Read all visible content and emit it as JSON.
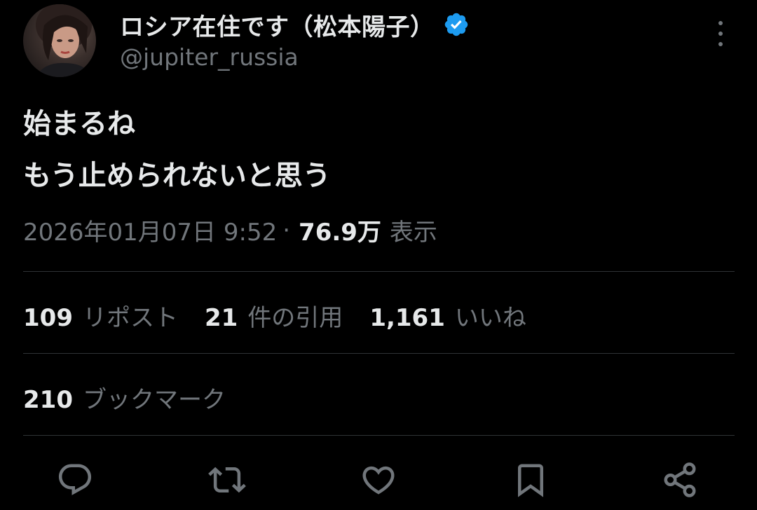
{
  "author": {
    "display_name": "ロシア在住です（松本陽子）",
    "handle": "@jupiter_russia",
    "verified": true
  },
  "tweet": {
    "lines": [
      "始まるね",
      "もう止められないと思う"
    ],
    "timestamp": "2026年01月07日 9:52",
    "separator": "·",
    "views_count": "76.9万",
    "views_label": "表示"
  },
  "stats": {
    "reposts": {
      "count": "109",
      "label": "リポスト"
    },
    "quotes": {
      "count": "21",
      "label": "件の引用"
    },
    "likes": {
      "count": "1,161",
      "label": "いいね"
    },
    "bookmarks": {
      "count": "210",
      "label": "ブックマーク"
    }
  },
  "actions": [
    {
      "icon": "reply-icon"
    },
    {
      "icon": "repost-icon"
    },
    {
      "icon": "like-icon"
    },
    {
      "icon": "bookmark-icon"
    },
    {
      "icon": "share-icon"
    }
  ],
  "colors": {
    "background": "#000000",
    "primary_text": "#e7e9ea",
    "secondary_text": "#71767b",
    "divider": "#2f3336",
    "verified_badge": "#1d9bf0"
  }
}
